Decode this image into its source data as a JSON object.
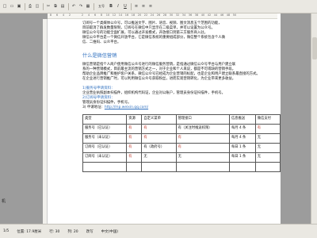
{
  "toolbar": {
    "buttons": [
      "new-icon",
      "open-icon",
      "save-icon",
      "print-icon",
      "preview-icon",
      "cut-icon",
      "copy-icon",
      "paste-icon",
      "undo-icon",
      "redo-icon",
      "table-icon",
      "bold-icon",
      "italic-icon",
      "underline-icon",
      "align-left-icon",
      "align-center-icon",
      "align-right-icon",
      "zoom-icon"
    ],
    "zoom_label": "五号"
  },
  "ruler": {
    "ticks": [
      "8",
      "6",
      "4",
      "2",
      "",
      "2",
      "4",
      "6",
      "8",
      "10",
      "12",
      "14",
      "16",
      "18",
      "20",
      "22",
      "24",
      "26",
      "28",
      "30",
      "32",
      "34",
      "36",
      "38",
      "40",
      "42",
      "44",
      "46",
      "48",
      "50"
    ]
  },
  "document": {
    "intro_lines": [
      "订阅号一个类媒体公众号，可以推送文字、图片、语音、视频、图文消息五个范围的功能，",
      "目前取消了群发数量限制，订阅号在微信中只显示在二级菜单，并可以设置为公众号。",
      "微信公众号的功能全面扩展，可以通过开发模式，开放接口到第三方服务商入驻。",
      "微信公众平台是一个微信开放平台，它是微信系统的重要组成部分，微信整个系统包含个人微",
      "信、二维码、公众平台。"
    ],
    "heading": "什么是微信营销",
    "body_lines": [
      "微信营销是指个人商户使用微信公众号进行的微信服务营销，是指通过微信公众号平台与用户建立联",
      "系的一种营销模式，目前最主流的营销方式之一，对于企业和个人来说，都是不可或缺的营销手段。",
      "帮助企业品牌推广和维护客户关系，微信公众号已经成为企业营销的标配，也是企业和用户建立联系最直接的方式。",
      "在企业进行营销推广时，可以利用微信公众号获取粉丝，进而实现营销转化，为企业带来更多收益。"
    ],
    "sub_blue_1": "1)服务号申请资料：",
    "sub_text_1": "企业营业执照副本扫描件，组织机构代码证，企业对公账户，管理员身份证扫描件，手机号。",
    "sub_blue_2": "2)订阅号申请资料：",
    "sub_text_2": "管理员身份证扫描件，手机号。",
    "link_prefix": "3) 申请地址：",
    "link_url": "http://mp.weixin.qq.com/"
  },
  "table": {
    "header": [
      "类型",
      "资源",
      "自定义菜单",
      "管理接口",
      "信息推送",
      "微信支付"
    ],
    "rows": [
      [
        "服务号（已认证）",
        "有",
        "有",
        "有（关注时推送权限）",
        "每月 4 条",
        "有"
      ],
      [
        "服务号（未认证）",
        "有",
        "有",
        "有",
        "每月 4 条",
        "无"
      ],
      [
        "订阅号（已认证）",
        "有",
        "有（政府号）",
        "有",
        "每日 1 条",
        "无"
      ],
      [
        "订阅号（未认证）",
        "有",
        "无",
        "无",
        "每日 1 条",
        "无"
      ],
      [
        "",
        "",
        "",
        "",
        "",
        ""
      ]
    ]
  },
  "sidebar_text": "机",
  "statusbar": {
    "page": "1/5",
    "position": "位置: 17.9厘米",
    "line": "行: 30",
    "column": "列: 20",
    "mode": "改写",
    "language": "中文(中国)"
  }
}
